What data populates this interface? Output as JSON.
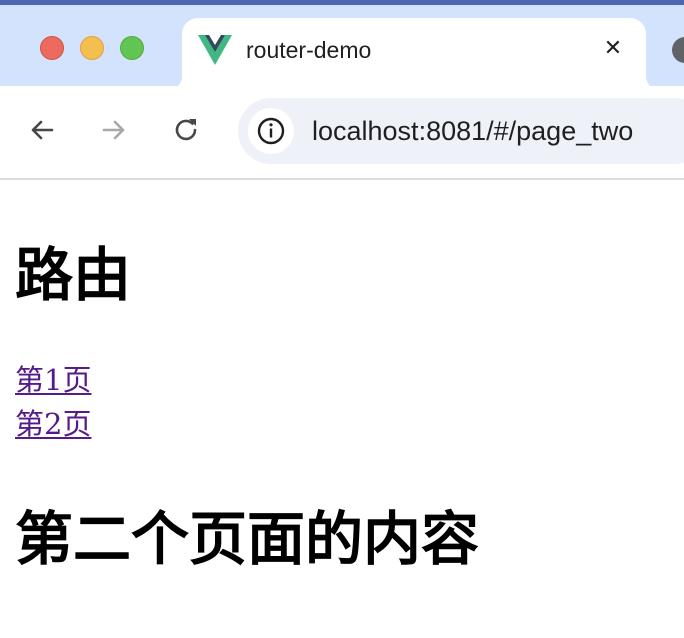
{
  "browser": {
    "tab": {
      "title": "router-demo",
      "close_glyph": "✕",
      "favicon": "vue-logo-icon"
    },
    "toolbar": {
      "back_icon": "arrow-left-icon",
      "forward_icon": "arrow-right-icon",
      "reload_icon": "reload-icon",
      "site_info_icon": "info-icon",
      "url": "localhost:8081/#/page_two"
    },
    "colors": {
      "tabstrip_bg": "#d3e3fd",
      "omnibox_bg": "#eef1f8",
      "traffic_close": "#ed6a5e",
      "traffic_minimize": "#f5bf4f",
      "traffic_maximize": "#61c554",
      "visited_link": "#551a8b"
    }
  },
  "page": {
    "heading": "路由",
    "links": [
      {
        "label": "第1页"
      },
      {
        "label": "第2页"
      }
    ],
    "view_heading": "第二个页面的内容"
  }
}
